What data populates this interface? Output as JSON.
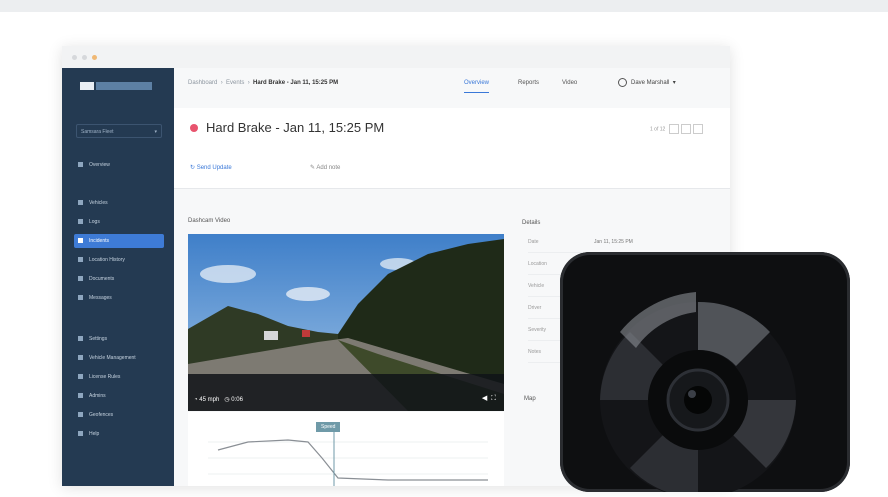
{
  "window": {
    "breadcrumb": {
      "root": "Dashboard",
      "section": "Events",
      "current": "Hard Brake - Jan 11, 15:25 PM"
    },
    "tabs": [
      {
        "label": "Overview",
        "active": true
      },
      {
        "label": "Reports",
        "active": false
      },
      {
        "label": "Video",
        "active": false
      }
    ],
    "user_name": "Dave Marshall"
  },
  "sidebar": {
    "selector_label": "Samsara Fleet",
    "main_items": [
      {
        "label": "Overview",
        "icon": "home-icon",
        "active": false
      },
      {
        "label": "Vehicles",
        "icon": "truck-icon",
        "active": false
      },
      {
        "label": "Logs",
        "icon": "list-icon",
        "active": false
      },
      {
        "label": "Incidents",
        "icon": "alert-icon",
        "active": true
      },
      {
        "label": "Location History",
        "icon": "pin-icon",
        "active": false
      },
      {
        "label": "Documents",
        "icon": "doc-icon",
        "active": false
      },
      {
        "label": "Messages",
        "icon": "chat-icon",
        "active": false
      }
    ],
    "section_title": "Settings",
    "secondary_items": [
      {
        "label": "Vehicle Management",
        "icon": "car-icon"
      },
      {
        "label": "License Rules",
        "icon": "shield-icon"
      },
      {
        "label": "Admins",
        "icon": "user-icon"
      },
      {
        "label": "Geofences",
        "icon": "map-icon"
      },
      {
        "label": "Help",
        "icon": "help-icon"
      }
    ]
  },
  "event": {
    "title": "Hard Brake - Jan 11, 15:25 PM",
    "status_color": "#e8546e",
    "pager": "1 of 12",
    "action_primary": "Send Update",
    "action_secondary": "Add note"
  },
  "video": {
    "section_label": "Dashcam Video",
    "speed": "45 mph",
    "time": "0:06",
    "chart_label": "Speed"
  },
  "details": {
    "section_label": "Details",
    "rows": [
      {
        "key": "Date",
        "value": "Jan 11, 15:25 PM"
      },
      {
        "key": "Location",
        "value": ""
      },
      {
        "key": "Vehicle",
        "value": ""
      },
      {
        "key": "Driver",
        "value": ""
      },
      {
        "key": "Severity",
        "value": ""
      },
      {
        "key": "Notes",
        "value": ""
      }
    ],
    "map_label": "Map"
  },
  "colors": {
    "sidebar": "#243a52",
    "accent": "#3e7bd6",
    "alert": "#e8546e"
  }
}
